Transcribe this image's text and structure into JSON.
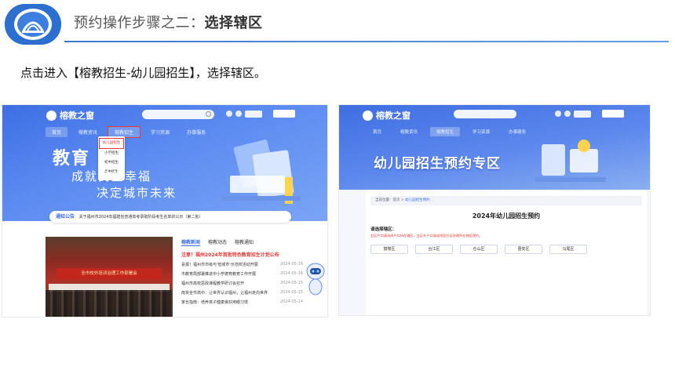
{
  "header": {
    "title_prefix": "预约操作步骤之二：",
    "title_bold": "选择辖区"
  },
  "instruction": "点击进入【榕教招生-幼儿园招生】，选择辖区。",
  "left_shot": {
    "site_name": "榕教之窗",
    "nav": [
      "首页",
      "榕教资讯",
      "榕教招生",
      "学习资源",
      "办事服务"
    ],
    "dropdown": [
      "幼儿园招生",
      "小学招生",
      "初中招生",
      "高中招生"
    ],
    "hero_word": "教育",
    "slogan1": "成就民生幸福",
    "slogan2": "决定城市未来",
    "notice_tag": "通知公告",
    "notice_text": "关于福州市2024年福建省普通高考录取阶段考生名单的公示（第二批）",
    "news_tabs": [
      "榕教新闻",
      "榕教动态",
      "榕教通知"
    ],
    "news_headline": "注意！福州2024年首批特色教育招生计划公布",
    "news_rows": [
      {
        "title": "喜报！福州市市级与'但城市'示范校活动开展",
        "date": "2024-05-16"
      },
      {
        "title": "市教育局部署推进中小学德育教育工作开展",
        "date": "2024-05-16"
      },
      {
        "title": "福州市高校思政课程教学研讨会召开",
        "date": "2024-05-15"
      },
      {
        "title": "南京全市高中：让世界认识福州，让福州走向世界",
        "date": "2024-05-15"
      },
      {
        "title": "家长指南：培养孩子健康良好用眼习惯",
        "date": "2024-05-14"
      }
    ],
    "photo_banner": "全市校外培训治理工作部署会"
  },
  "right_shot": {
    "site_name": "榕教之窗",
    "nav": [
      "首页",
      "榕教资讯",
      "榕教招生",
      "学习资源",
      "办事服务"
    ],
    "banner": "幼儿园招生预约专区",
    "breadcrumb_prefix": "当前位置：首页 >",
    "breadcrumb_current": "幼儿园招生预约",
    "card_title": "2024年幼儿园招生预约",
    "choose_label": "请选择辖区：",
    "warning": "五区户口请选择户口所在辖区，五区外户口请选择居住证办理所在辖区预约。",
    "districts": [
      "鼓楼区",
      "台江区",
      "仓山区",
      "晋安区",
      "马尾区"
    ]
  }
}
